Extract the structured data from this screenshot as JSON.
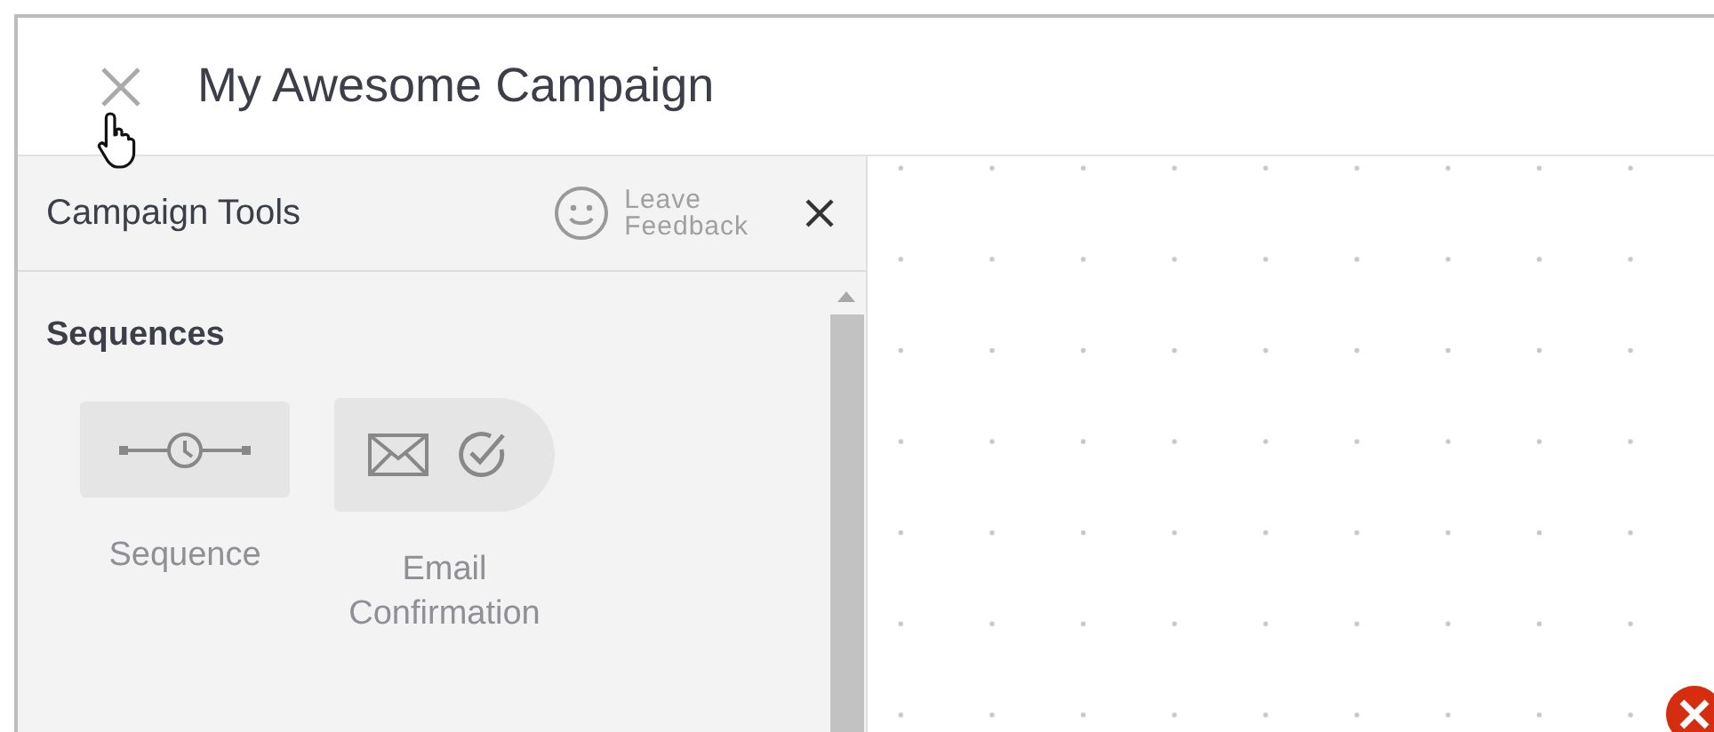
{
  "header": {
    "title": "My Awesome Campaign"
  },
  "panel": {
    "title": "Campaign Tools",
    "feedback": [
      "Leave",
      "Feedback"
    ]
  },
  "section": {
    "title": "Sequences",
    "tools": [
      {
        "kind": "sequence",
        "label": "Sequence"
      },
      {
        "kind": "email",
        "label": "Email Confirmation"
      }
    ]
  }
}
